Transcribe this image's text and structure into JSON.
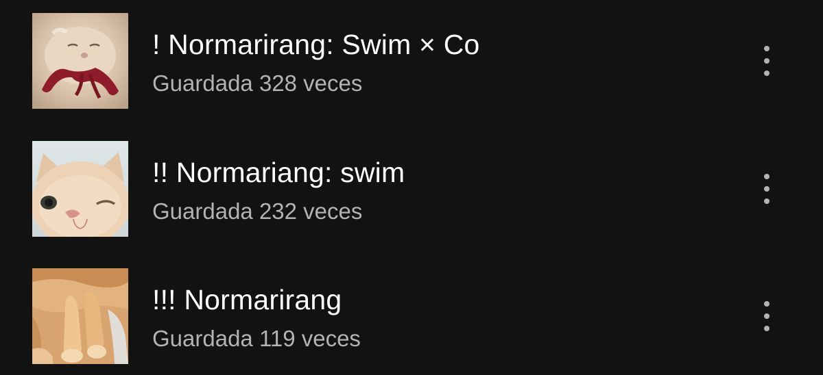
{
  "playlists": [
    {
      "title": "! Normarirang: Swim × Co",
      "saves": "Guardada 328 veces",
      "cover_icon": "cat-with-red-ribbon-photo",
      "menu_icon": "more-options-vertical-icon"
    },
    {
      "title": "!! Normariang: swim",
      "saves": "Guardada 232 veces",
      "cover_icon": "winking-cat-photo",
      "menu_icon": "more-options-vertical-icon"
    },
    {
      "title": "!!! Normarirang",
      "saves": "Guardada 119 veces",
      "cover_icon": "cat-paws-photo",
      "menu_icon": "more-options-vertical-icon"
    }
  ],
  "colors": {
    "background": "#121212",
    "title_text": "#ffffff",
    "subtitle_text": "#b3b3b3",
    "ribbon": "#8e1c2a"
  }
}
